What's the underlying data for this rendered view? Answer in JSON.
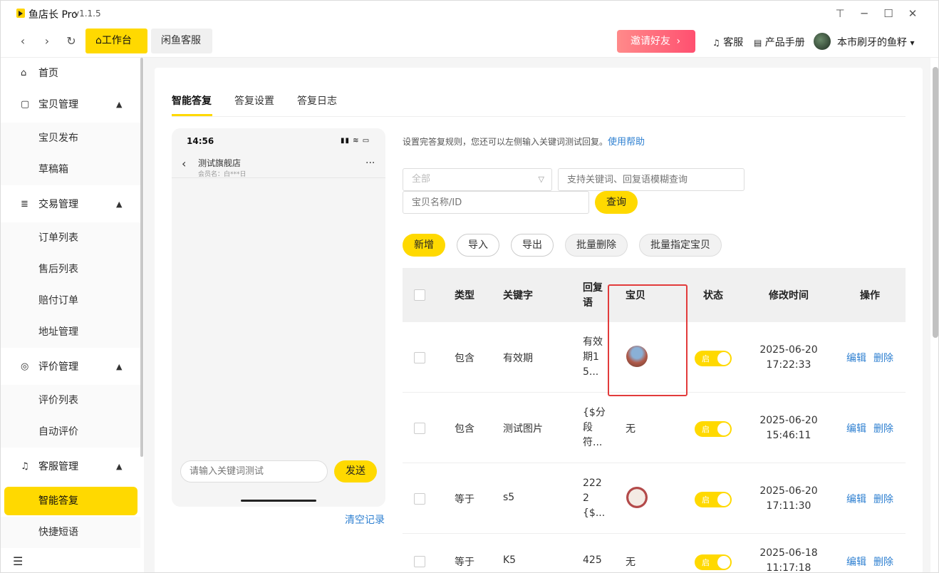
{
  "window": {
    "app_name": "鱼店长 Pro",
    "version": "v1.1.5",
    "pin": "⊤",
    "minimize": "─",
    "maximize": "☐",
    "close": "✕"
  },
  "topbar": {
    "back": "‹",
    "forward": "›",
    "refresh": "↻",
    "tabs": [
      {
        "icon": "⌂",
        "label": "工作台"
      },
      {
        "label": "闲鱼客服"
      }
    ],
    "invite_label": "邀请好友",
    "invite_arrow": "›",
    "service_label": "客服",
    "manual_label": "产品手册",
    "user_name": "本市刷牙的鱼籽",
    "user_caret": "▾"
  },
  "sidebar": {
    "items": [
      {
        "type": "link",
        "icon": "⌂",
        "label": "首页"
      },
      {
        "type": "group",
        "icon": "▢",
        "label": "宝贝管理",
        "caret": "▲"
      },
      {
        "type": "sub",
        "label": "宝贝发布"
      },
      {
        "type": "sub",
        "label": "草稿箱"
      },
      {
        "type": "group",
        "icon": "≣",
        "label": "交易管理",
        "caret": "▲"
      },
      {
        "type": "sub",
        "label": "订单列表"
      },
      {
        "type": "sub",
        "label": "售后列表"
      },
      {
        "type": "sub",
        "label": "赔付订单"
      },
      {
        "type": "sub",
        "label": "地址管理"
      },
      {
        "type": "group",
        "icon": "◎",
        "label": "评价管理",
        "caret": "▲"
      },
      {
        "type": "sub",
        "label": "评价列表"
      },
      {
        "type": "sub",
        "label": "自动评价"
      },
      {
        "type": "group",
        "icon": "♫",
        "label": "客服管理",
        "caret": "▲"
      },
      {
        "type": "sub",
        "label": "智能答复",
        "active": true
      },
      {
        "type": "sub",
        "label": "快捷短语"
      }
    ],
    "collapse_icon": "☰"
  },
  "main": {
    "tabs": [
      "智能答复",
      "答复设置",
      "答复日志"
    ],
    "phone": {
      "time": "14:56",
      "status_icons": "▮▮ ≋ ▭",
      "back": "‹",
      "shop_name": "测试旗舰店",
      "member": "会员名：白***日",
      "more": "···",
      "input_placeholder": "请输入关键词测试",
      "send_label": "发送"
    },
    "clear_log": "清空记录",
    "hint": "设置完答复规则，您还可以左侧输入关键词测试回复。",
    "help_link": "使用帮助",
    "filter": {
      "type_select": "全部",
      "select_chevron": "▽",
      "keyword_placeholder": "支持关键词、回复语模糊查询",
      "item_placeholder": "宝贝名称/ID",
      "search_label": "查询"
    },
    "actions": {
      "add": "新增",
      "import": "导入",
      "export": "导出",
      "batch_delete": "批量删除",
      "batch_assign": "批量指定宝贝"
    },
    "table": {
      "headers": {
        "type": "类型",
        "keyword": "关键字",
        "reply": "回复语",
        "item": "宝贝",
        "status": "状态",
        "time": "修改时间",
        "ops": "操作"
      },
      "rows": [
        {
          "type": "包含",
          "keyword": "有效期",
          "reply": "有效期15...",
          "item": "",
          "item_thumb": "photo",
          "status": "启",
          "time1": "2025-06-20",
          "time2": "17:22:33",
          "edit": "编辑",
          "delete": "删除"
        },
        {
          "type": "包含",
          "keyword": "测试图片",
          "reply": "{$分段符...",
          "item": "无",
          "item_thumb": "",
          "status": "启",
          "time1": "2025-06-20",
          "time2": "15:46:11",
          "edit": "编辑",
          "delete": "删除"
        },
        {
          "type": "等于",
          "keyword": "s5",
          "reply": "2222{$...",
          "item": "",
          "item_thumb": "badge",
          "status": "启",
          "time1": "2025-06-20",
          "time2": "17:11:30",
          "edit": "编辑",
          "delete": "删除"
        },
        {
          "type": "等于",
          "keyword": "K5",
          "reply": "425",
          "item": "无",
          "item_thumb": "",
          "status": "启",
          "time1": "2025-06-18",
          "time2": "11:17:18",
          "edit": "编辑",
          "delete": "删除"
        }
      ]
    }
  },
  "colors": {
    "accent": "#ffd900",
    "link": "#2f80d1",
    "highlight": "#e23b3b"
  }
}
